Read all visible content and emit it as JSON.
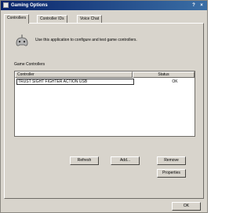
{
  "window": {
    "title": "Gaming Options",
    "help_label": "?",
    "close_label": "×"
  },
  "tabs": [
    {
      "label": "Controllers",
      "active": true
    },
    {
      "label": "Controller IDs",
      "active": false
    },
    {
      "label": "Voice Chat",
      "active": false
    }
  ],
  "description": "Use this application to configure and test game controllers.",
  "group_label": "Game Controllers",
  "list": {
    "columns": [
      "Controller",
      "Status"
    ],
    "rows": [
      {
        "controller": "TRUST SIGHT FIGHTER ACTION USB",
        "status": "OK"
      }
    ]
  },
  "buttons": {
    "refresh": "Refresh",
    "add": "Add...",
    "remove": "Remove",
    "properties": "Properties",
    "ok": "OK"
  },
  "icons": {
    "app": "gamepad-window-icon",
    "gamepad": "gamepad-icon"
  }
}
